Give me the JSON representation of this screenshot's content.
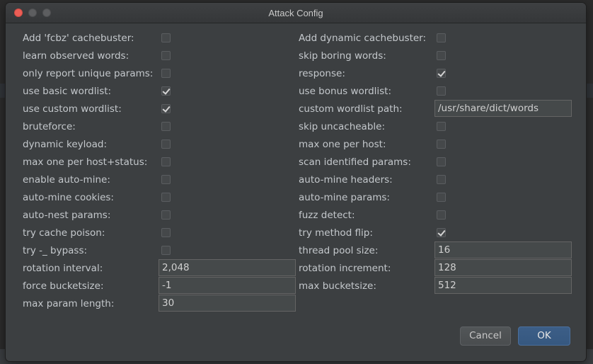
{
  "window": {
    "title": "Attack Config"
  },
  "left_checkboxes": [
    {
      "label": "Add 'fcbz' cachebuster:",
      "checked": false
    },
    {
      "label": "learn observed words:",
      "checked": false
    },
    {
      "label": "only report unique params:",
      "checked": false
    },
    {
      "label": "use basic wordlist:",
      "checked": true
    },
    {
      "label": "use custom wordlist:",
      "checked": true
    },
    {
      "label": "bruteforce:",
      "checked": false
    },
    {
      "label": "dynamic keyload:",
      "checked": false
    },
    {
      "label": "max one per host+status:",
      "checked": false
    },
    {
      "label": "enable auto-mine:",
      "checked": false
    },
    {
      "label": "auto-mine cookies:",
      "checked": false
    },
    {
      "label": "auto-nest params:",
      "checked": false
    },
    {
      "label": "try cache poison:",
      "checked": false
    },
    {
      "label": "try -_ bypass:",
      "checked": false
    }
  ],
  "right_checkboxes": [
    {
      "label": "Add dynamic cachebuster:",
      "checked": false
    },
    {
      "label": "skip boring words:",
      "checked": false
    },
    {
      "label": "response:",
      "checked": true
    },
    {
      "label": "use bonus wordlist:",
      "checked": false
    },
    {
      "label": "custom wordlist path:",
      "value": "/usr/share/dict/words"
    },
    {
      "label": "skip uncacheable:",
      "checked": false
    },
    {
      "label": "max one per host:",
      "checked": false
    },
    {
      "label": "scan identified params:",
      "checked": false
    },
    {
      "label": "auto-mine headers:",
      "checked": false
    },
    {
      "label": "auto-mine params:",
      "checked": false
    },
    {
      "label": "fuzz detect:",
      "checked": false
    },
    {
      "label": "try method flip:",
      "checked": true
    }
  ],
  "left_fields": [
    {
      "label": "rotation interval:",
      "value": "2,048"
    },
    {
      "label": "force bucketsize:",
      "value": "-1"
    },
    {
      "label": "max param length:",
      "value": "30"
    }
  ],
  "right_fields": [
    {
      "label": "thread pool size:",
      "value": "16"
    },
    {
      "label": "rotation increment:",
      "value": "128"
    },
    {
      "label": "max bucketsize:",
      "value": "512"
    }
  ],
  "buttons": {
    "cancel": "Cancel",
    "ok": "OK"
  }
}
